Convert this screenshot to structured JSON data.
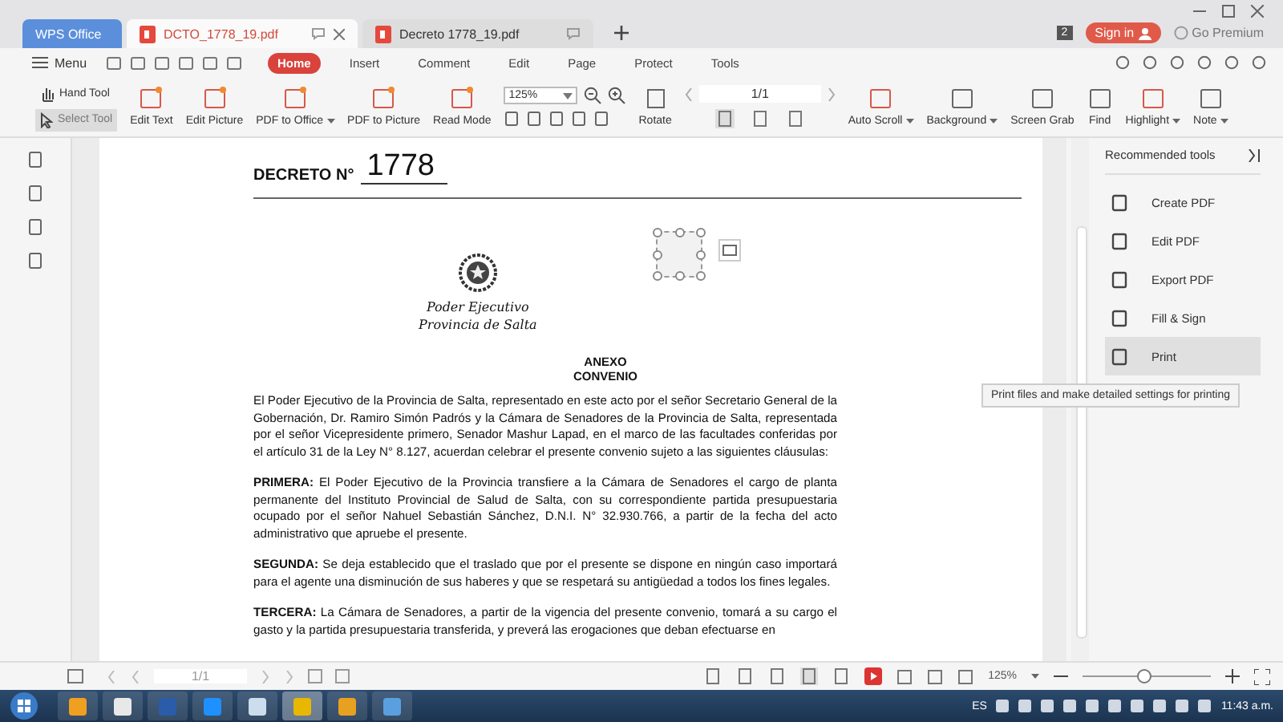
{
  "window_tabs": [
    {
      "label": "WPS Office",
      "kind": "home",
      "selected": false
    },
    {
      "label": "DCTO_1778_19.pdf",
      "kind": "pdf",
      "selected": true
    },
    {
      "label": "Decreto 1778_19.pdf",
      "kind": "pdf",
      "selected": false
    }
  ],
  "header_right": {
    "badge": "2",
    "sign_in": "Sign in",
    "premium": "Go Premium"
  },
  "menu": {
    "label": "Menu",
    "tabs": [
      {
        "label": "Home",
        "selected": true
      },
      {
        "label": "Insert",
        "selected": false
      },
      {
        "label": "Comment",
        "selected": false
      },
      {
        "label": "Edit",
        "selected": false
      },
      {
        "label": "Page",
        "selected": false
      },
      {
        "label": "Protect",
        "selected": false
      },
      {
        "label": "Tools",
        "selected": false
      }
    ]
  },
  "toolbar": {
    "hand_tool": {
      "label": "Hand Tool",
      "selected": false
    },
    "select_tool": {
      "label": "Select Tool",
      "selected": true
    },
    "tools_left": [
      {
        "label": "Edit Text",
        "dropdown": false
      },
      {
        "label": "Edit Picture",
        "dropdown": false
      },
      {
        "label": "PDF to Office",
        "dropdown": true
      },
      {
        "label": "PDF to Picture",
        "dropdown": false
      },
      {
        "label": "Read Mode",
        "dropdown": false
      }
    ],
    "zoom": "125%",
    "rotate": "Rotate",
    "page": "1/1",
    "tools_right": [
      {
        "label": "Auto Scroll",
        "dropdown": true
      },
      {
        "label": "Background",
        "dropdown": true
      },
      {
        "label": "Screen Grab",
        "dropdown": false
      },
      {
        "label": "Find",
        "dropdown": false
      },
      {
        "label": "Highlight",
        "dropdown": true
      },
      {
        "label": "Note",
        "dropdown": true
      }
    ]
  },
  "document": {
    "decree_label": "DECRETO N°",
    "decree_number": "1778",
    "seal_text": [
      "Poder Ejecutivo",
      "Provincia de Salta"
    ],
    "heading": [
      "ANEXO",
      "CONVENIO"
    ],
    "paragraphs": [
      "El Poder Ejecutivo de la Provincia de Salta, representado en este acto por el señor Secretario General de la Gobernación, Dr. Ramiro Simón Padrós y la Cámara de Senadores de la Provincia de Salta, representada por el señor Vicepresidente primero, Senador Mashur Lapad, en el marco de las facultades conferidas por el artículo 31 de la Ley N° 8.127, acuerdan celebrar el presente convenio sujeto a las siguientes cláusulas:",
      "**PRIMERA:** El Poder Ejecutivo de la Provincia transfiere a la Cámara de Senadores el cargo de planta permanente del Instituto Provincial de Salud de Salta, con su correspondiente partida presupuestaria ocupado por el señor Nahuel Sebastián Sánchez, D.N.I. N° 32.930.766, a partir de la fecha del acto administrativo que apruebe el presente.",
      "**SEGUNDA:** Se deja establecido que el traslado que por el presente se dispone en ningún caso importará para el agente una disminución de sus haberes y que se respetará su antigüedad a todos los fines legales.",
      "**TERCERA:** La Cámara de Senadores, a partir de la vigencia del presente convenio, tomará a su cargo el gasto y la partida presupuestaria transferida, y preverá las erogaciones que deban efectuarse en"
    ]
  },
  "right_panel": {
    "title": "Recommended tools",
    "items": [
      {
        "label": "Create PDF",
        "highlighted": false
      },
      {
        "label": "Edit PDF",
        "highlighted": false
      },
      {
        "label": "Export PDF",
        "highlighted": false
      },
      {
        "label": "Fill & Sign",
        "highlighted": false
      },
      {
        "label": "Print",
        "highlighted": true
      }
    ],
    "tooltip": "Print files and make detailed settings for printing"
  },
  "status_bar": {
    "page": "1/1",
    "zoom": "125%",
    "zoom_slider": {
      "level": 0.47
    }
  },
  "taskbar": {
    "language": "ES",
    "clock": "11:43 a.m."
  }
}
